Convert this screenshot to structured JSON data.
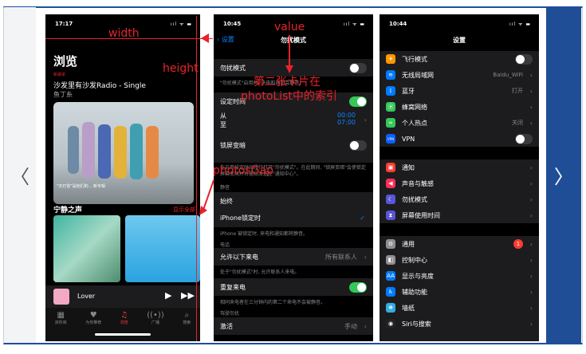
{
  "nav": {
    "prev": "〈",
    "next": "〉"
  },
  "phone1": {
    "time": "17:17",
    "signal": "ııl ᯤ ▬",
    "title": "浏览",
    "badge": "新歌单",
    "song": "沙发里有沙发Radio - Single",
    "artist": "鱼丁糸",
    "caption": "\"天打雷\"是他们的... 新专辑",
    "section": "宁静之声",
    "more": "显示全部",
    "player": "Lover",
    "tabs": [
      "资料库",
      "为你推荐",
      "浏览",
      "广播",
      "搜索"
    ]
  },
  "phone2": {
    "time": "10:45",
    "signal": "ııl ᯤ ▬",
    "back": "设置",
    "title": "勿扰模式",
    "dnd": "勿扰模式",
    "dnd_note": "\"勿扰模式\"启用时, 来电和通知会静音。",
    "scheduled": "设定时间",
    "from": "从",
    "to": "至",
    "from_t": "00:00",
    "to_t": "07:00",
    "dim": "锁屏变暗",
    "dim_note": "在启用设定时间段行打开\"勿扰模式\"。在此期间, \"锁屏变暗\"会使锁定屏幕变暗并将通知发送至\"通知中心\"。",
    "silence": "静音",
    "always": "始终",
    "locked": "iPhone锁定时",
    "locked_note": "iPhone 被锁定时, 来电和通知都将静音。",
    "phone": "电话",
    "allow": "允许以下来电",
    "allow_val": "所有联系人",
    "allow_note": "处于\"勿扰模式\"时, 允许联系人来电。",
    "repeat": "重复来电",
    "repeat_note": "相同来电者在三分钟内的第二个来电不会被静音。",
    "driving": "驾驶勿扰",
    "activate": "激活",
    "activate_val": "手动"
  },
  "phone3": {
    "time": "10:44",
    "signal": "ııl ᯤ ▬",
    "title": "设置",
    "g1": [
      {
        "label": "飞行模式",
        "color": "#ff9500",
        "glyph": "✈",
        "toggle": "off"
      },
      {
        "label": "无线局域网",
        "color": "#007aff",
        "glyph": "≋",
        "value": "Baidu_WiFi"
      },
      {
        "label": "蓝牙",
        "color": "#007aff",
        "glyph": "ᛒ",
        "value": "打开"
      },
      {
        "label": "蜂窝网络",
        "color": "#34c759",
        "glyph": "⦿"
      },
      {
        "label": "个人热点",
        "color": "#34c759",
        "glyph": "∞",
        "value": "关闭"
      },
      {
        "label": "VPN",
        "color": "#0a60ff",
        "glyph": "VPN",
        "toggle": "off"
      }
    ],
    "g2": [
      {
        "label": "通知",
        "color": "#ff3b30",
        "glyph": "▣"
      },
      {
        "label": "声音与触感",
        "color": "#ff2d55",
        "glyph": "◀"
      },
      {
        "label": "勿扰模式",
        "color": "#5856d6",
        "glyph": "☾"
      },
      {
        "label": "屏幕使用时间",
        "color": "#5856d6",
        "glyph": "⧗"
      }
    ],
    "g3": [
      {
        "label": "通用",
        "color": "#8e8e93",
        "glyph": "⚙",
        "badge": "1"
      },
      {
        "label": "控制中心",
        "color": "#8e8e93",
        "glyph": "◧"
      },
      {
        "label": "显示与亮度",
        "color": "#007aff",
        "glyph": "AA"
      },
      {
        "label": "辅助功能",
        "color": "#007aff",
        "glyph": "♿"
      },
      {
        "label": "墙纸",
        "color": "#32ade6",
        "glyph": "❋"
      },
      {
        "label": "Siri与搜索",
        "color": "#222",
        "glyph": "◉"
      }
    ]
  },
  "annotations": {
    "width": "width",
    "height": "height",
    "photosGap": "photosGap",
    "value": "value",
    "note1": "第二张卡片在",
    "note2": "photoList中的索引"
  }
}
